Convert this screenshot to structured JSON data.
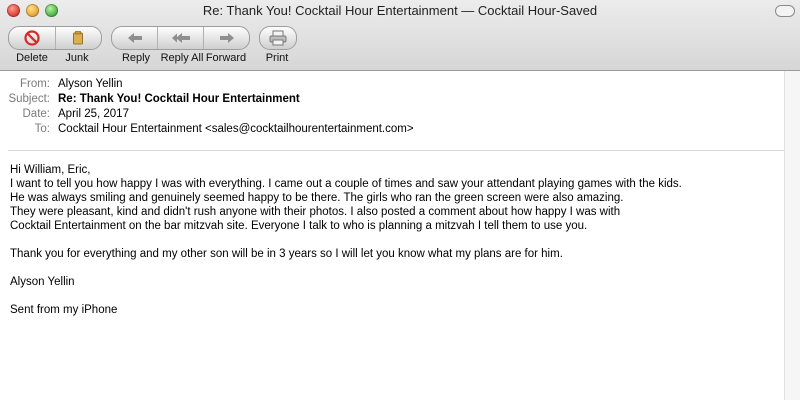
{
  "window": {
    "title": "Re: Thank You! Cocktail Hour Entertainment — Cocktail Hour-Saved"
  },
  "toolbar": {
    "delete_label": "Delete",
    "junk_label": "Junk",
    "reply_label": "Reply",
    "reply_all_label": "Reply All",
    "forward_label": "Forward",
    "print_label": "Print"
  },
  "header": {
    "from_label": "From:",
    "from_value": "Alyson Yellin",
    "subject_label": "Subject:",
    "subject_value": "Re: Thank You! Cocktail Hour Entertainment",
    "date_label": "Date:",
    "date_value": "April 25, 2017",
    "to_label": "To:",
    "to_value": "Cocktail Hour Entertainment <sales@cocktailhourentertainment.com>"
  },
  "message": {
    "greeting": "Hi William, Eric,",
    "line1": "I want to tell you how happy I was with everything. I came out a couple of times and saw your attendant playing games with the kids.",
    "line2": "He was always smiling and genuinely seemed happy to be there. The girls who ran the green screen were also amazing.",
    "line3": "They were pleasant, kind and didn't rush anyone with their photos. I also posted a comment about how happy I was with",
    "line4": "Cocktail Entertainment on the bar mitzvah site. Everyone I talk to who is planning a mitzvah I tell them to use you.",
    "line5": "Thank you for everything and my other son will be in 3 years so I will let you know what my plans are for him.",
    "signature": "Alyson Yellin",
    "footer": "Sent from my iPhone"
  },
  "colors": {
    "delete_icon": "#d42b2b",
    "junk_icon": "#c99a3a",
    "arrow_icon": "#8e8e8e"
  }
}
